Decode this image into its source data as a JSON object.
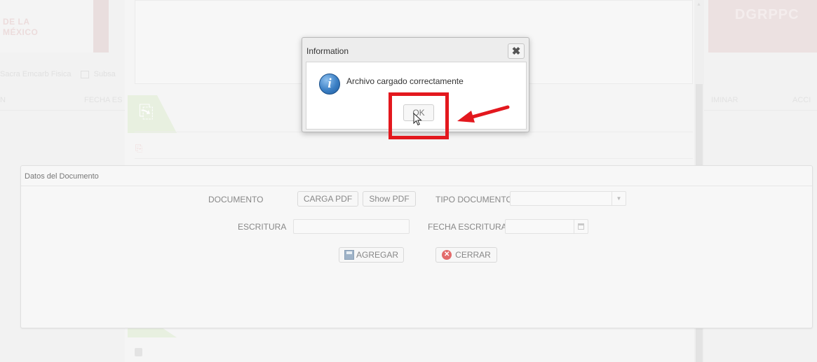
{
  "background": {
    "header_left": {
      "line1": "DE LA",
      "line2": "MÉXICO"
    },
    "header_right": {
      "brand": "DGRPPC"
    },
    "toolbar": {
      "text": "Sacra Emcarb Fisica",
      "item2": "Subsa"
    },
    "table_headers": [
      "N",
      "FECHA ES",
      "IMINAR",
      "ACCI"
    ]
  },
  "panel": {
    "title": "Datos del Documento",
    "documento_label": "DOCUMENTO",
    "carga_pdf_label": "CARGA PDF",
    "show_pdf_label": "Show PDF",
    "tipo_documento_label": "TIPO DOCUMENTO",
    "tipo_documento_value": "",
    "escritura_label": "ESCRITURA",
    "escritura_value": "",
    "fecha_escritura_label": "FECHA ESCRITURA",
    "fecha_escritura_value": "",
    "agregar_label": "AGREGAR",
    "cerrar_label": "CERRAR"
  },
  "dialog": {
    "title": "Information",
    "close_glyph": "✖",
    "icon_glyph": "i",
    "message": "Archivo cargado correctamente",
    "ok_label": "OK"
  },
  "annotation": {
    "highlight_color": "#e3181e"
  }
}
